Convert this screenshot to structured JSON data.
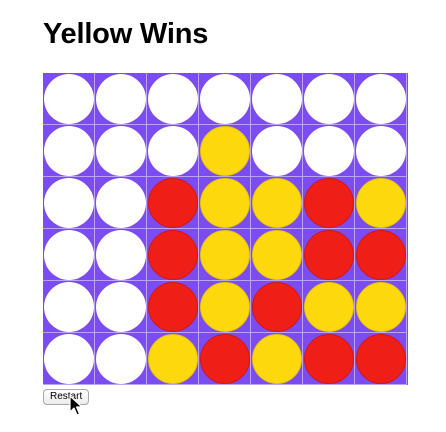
{
  "title": "Yellow Wins",
  "restart_label": "Restart",
  "colors": {
    "board": "#7b4cf2",
    "red": "#ef1f17",
    "yellow": "#fcd80c",
    "empty": "#ffffff"
  },
  "board": [
    [
      "empty",
      "empty",
      "empty",
      "empty",
      "empty",
      "empty",
      "empty"
    ],
    [
      "empty",
      "empty",
      "empty",
      "yellow",
      "empty",
      "empty",
      "empty"
    ],
    [
      "empty",
      "empty",
      "red",
      "yellow",
      "yellow",
      "red",
      "yellow"
    ],
    [
      "empty",
      "empty",
      "red",
      "yellow",
      "yellow",
      "red",
      "red"
    ],
    [
      "empty",
      "empty",
      "red",
      "yellow",
      "red",
      "yellow",
      "yellow"
    ],
    [
      "empty",
      "empty",
      "yellow",
      "red",
      "yellow",
      "red",
      "red"
    ]
  ]
}
